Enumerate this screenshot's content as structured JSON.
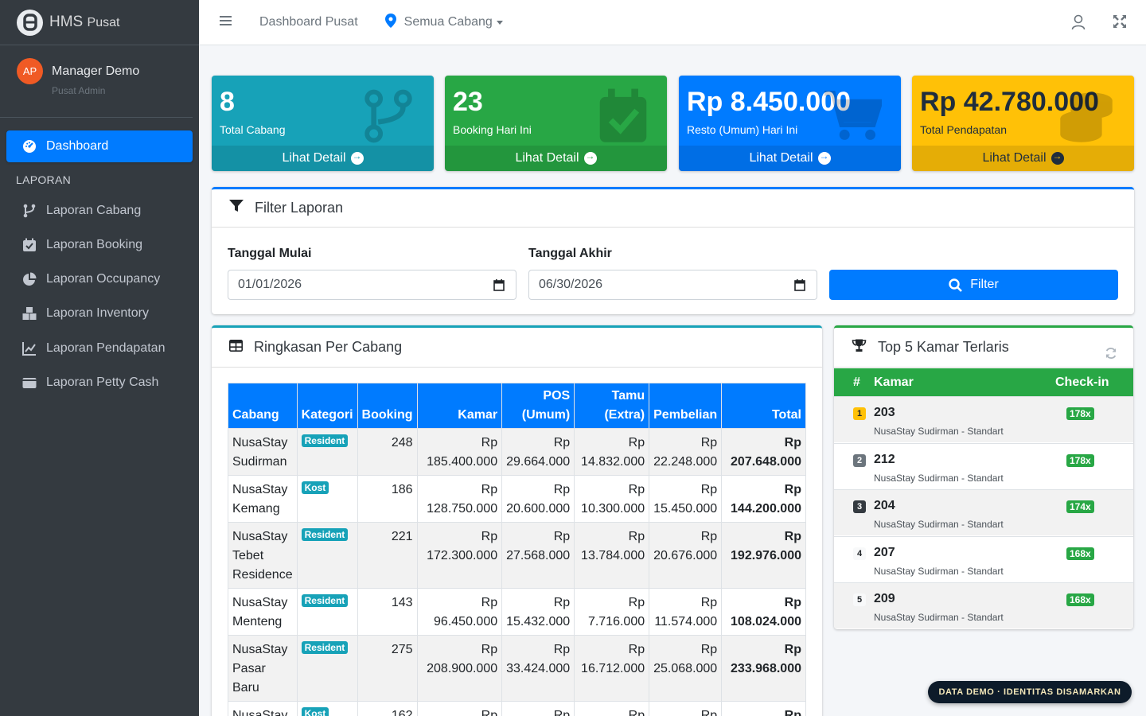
{
  "brand": {
    "name": "HMS",
    "suffix": "Pusat"
  },
  "user": {
    "initials": "AP",
    "name": "Manager Demo",
    "role": "Pusat Admin"
  },
  "sidebar": {
    "active": {
      "label": "Dashboard",
      "icon": "tachometer-icon"
    },
    "section_header": "LAPORAN",
    "items": [
      {
        "label": "Laporan Cabang",
        "icon": "branch-icon"
      },
      {
        "label": "Laporan Booking",
        "icon": "calendar-check-icon"
      },
      {
        "label": "Laporan Occupancy",
        "icon": "pie-chart-icon"
      },
      {
        "label": "Laporan Inventory",
        "icon": "boxes-icon"
      },
      {
        "label": "Laporan Pendapatan",
        "icon": "line-chart-icon"
      },
      {
        "label": "Laporan Petty Cash",
        "icon": "wallet-icon"
      }
    ]
  },
  "topbar": {
    "title": "Dashboard Pusat",
    "branch_select": "Semua Cabang"
  },
  "stats": [
    {
      "value": "8",
      "label": "Total Cabang",
      "link": "Lihat Detail",
      "color": "#17a2b8",
      "icon": "branch-icon"
    },
    {
      "value": "23",
      "label": "Booking Hari Ini",
      "link": "Lihat Detail",
      "color": "#28a745",
      "icon": "calendar-check-icon"
    },
    {
      "value": "Rp 8.450.000",
      "label": "Resto (Umum) Hari Ini",
      "link": "Lihat Detail",
      "color": "#007bff",
      "icon": "cart-icon"
    },
    {
      "value": "Rp 42.780.000",
      "label": "Total Pendapatan",
      "link": "Lihat Detail",
      "color": "#ffc107",
      "icon": "coins-icon"
    }
  ],
  "filter": {
    "title": "Filter Laporan",
    "start_label": "Tanggal Mulai",
    "start_value": "01/01/2026",
    "end_label": "Tanggal Akhir",
    "end_value": "06/30/2026",
    "button": "Filter"
  },
  "summary": {
    "title": "Ringkasan Per Cabang",
    "columns": [
      "Cabang",
      "Kategori",
      "Booking",
      "Kamar",
      "POS (Umum)",
      "Tamu (Extra)",
      "Pembelian",
      "Total"
    ],
    "rows": [
      {
        "cabang": "NusaStay Sudirman",
        "kategori": "Resident",
        "booking": "248",
        "kamar": "Rp 185.400.000",
        "pos": "Rp 29.664.000",
        "tamu": "Rp 14.832.000",
        "pembelian": "Rp 22.248.000",
        "total": "Rp 207.648.000"
      },
      {
        "cabang": "NusaStay Kemang",
        "kategori": "Kost",
        "booking": "186",
        "kamar": "Rp 128.750.000",
        "pos": "Rp 20.600.000",
        "tamu": "Rp 10.300.000",
        "pembelian": "Rp 15.450.000",
        "total": "Rp 144.200.000"
      },
      {
        "cabang": "NusaStay Tebet Residence",
        "kategori": "Resident",
        "booking": "221",
        "kamar": "Rp 172.300.000",
        "pos": "Rp 27.568.000",
        "tamu": "Rp 13.784.000",
        "pembelian": "Rp 20.676.000",
        "total": "Rp 192.976.000"
      },
      {
        "cabang": "NusaStay Menteng",
        "kategori": "Resident",
        "booking": "143",
        "kamar": "Rp 96.450.000",
        "pos": "Rp 15.432.000",
        "tamu": "Rp 7.716.000",
        "pembelian": "Rp 11.574.000",
        "total": "Rp 108.024.000"
      },
      {
        "cabang": "NusaStay Pasar Baru",
        "kategori": "Resident",
        "booking": "275",
        "kamar": "Rp 208.900.000",
        "pos": "Rp 33.424.000",
        "tamu": "Rp 16.712.000",
        "pembelian": "Rp 25.068.000",
        "total": "Rp 233.968.000"
      },
      {
        "cabang": "NusaStay",
        "kategori": "Kost",
        "booking": "162",
        "kamar": "Rp",
        "pos": "Rp",
        "tamu": "Rp",
        "pembelian": "Rp",
        "total": "Rp"
      }
    ]
  },
  "top5": {
    "title": "Top 5 Kamar Terlaris",
    "col_rank": "#",
    "col_room": "Kamar",
    "col_checkin": "Check-in",
    "rows": [
      {
        "rank": "1",
        "room": "203",
        "branch": "NusaStay Sudirman - Standart",
        "checkin": "178x",
        "rank_color": "#ffc107"
      },
      {
        "rank": "2",
        "room": "212",
        "branch": "NusaStay Sudirman - Standart",
        "checkin": "178x",
        "rank_color": "#6c757d"
      },
      {
        "rank": "3",
        "room": "204",
        "branch": "NusaStay Sudirman - Standart",
        "checkin": "174x",
        "rank_color": "#343a40"
      },
      {
        "rank": "4",
        "room": "207",
        "branch": "NusaStay Sudirman - Standart",
        "checkin": "168x",
        "rank_color": "#f8f9fa"
      },
      {
        "rank": "5",
        "room": "209",
        "branch": "NusaStay Sudirman - Standart",
        "checkin": "168x",
        "rank_color": "#f8f9fa"
      }
    ]
  },
  "demo_badge": "DATA DEMO · IDENTITAS DISAMARKAN"
}
